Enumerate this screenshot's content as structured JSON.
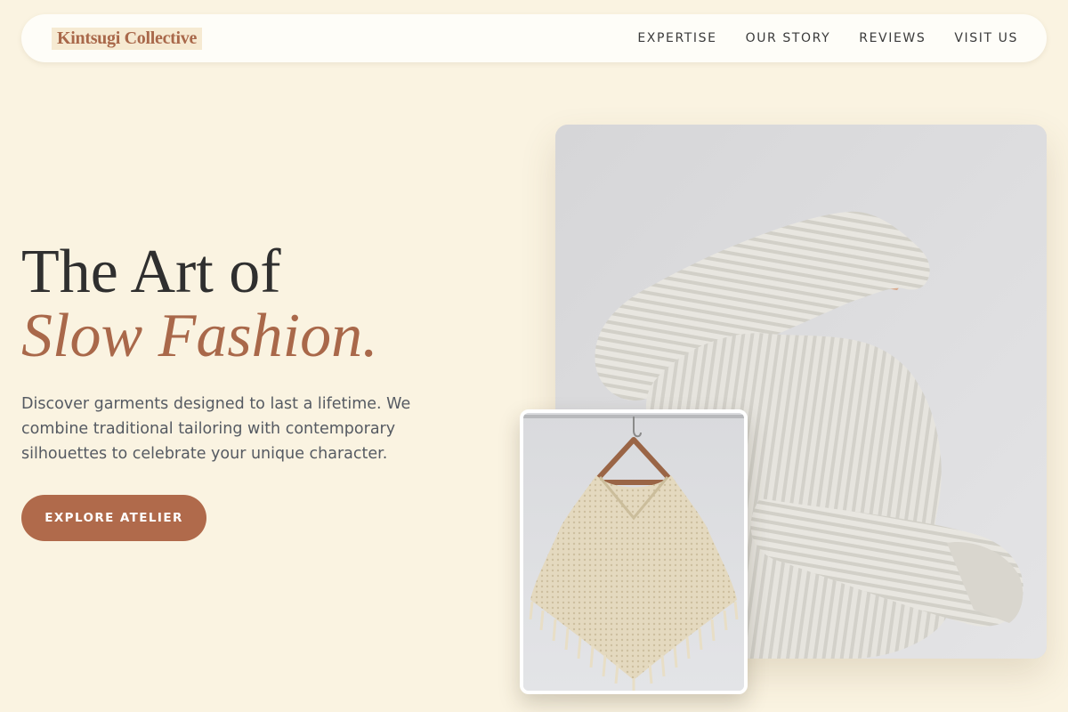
{
  "brand": {
    "name": "Kintsugi Collective"
  },
  "nav": {
    "items": [
      {
        "label": "EXPERTISE"
      },
      {
        "label": "OUR STORY"
      },
      {
        "label": "REVIEWS"
      },
      {
        "label": "VISIT US"
      }
    ]
  },
  "hero": {
    "title_line1": "The Art of",
    "title_line2": "Slow Fashion.",
    "description": "Discover garments designed to last a lifetime. We combine traditional tailoring with contemporary silhouettes to celebrate your unique character.",
    "cta_label": "EXPLORE ATELIER"
  },
  "images": {
    "main": "person-in-white-knit-sweater-photo",
    "secondary": "cream-crochet-poncho-on-hanger-photo"
  },
  "colors": {
    "background": "#faf3e1",
    "accent": "#b06a4b",
    "heading": "#2f2f2f",
    "body_text": "#555a62",
    "nav_bg": "#fefdf8"
  }
}
